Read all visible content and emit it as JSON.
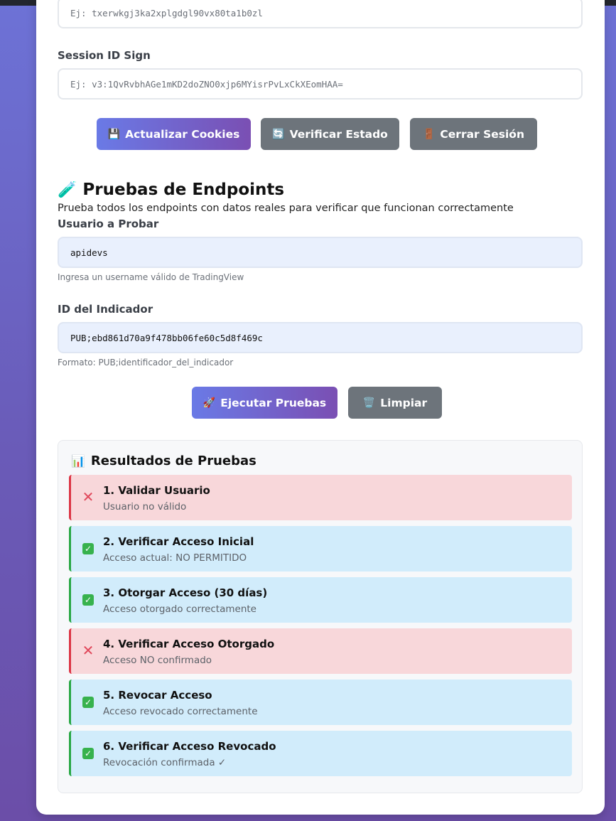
{
  "cookies": {
    "session_id_placeholder": "Ej: txerwkgj3ka2xplgdgl90vx80ta1b0zl",
    "session_sign_label": "Session ID Sign",
    "session_sign_placeholder": "Ej: v3:1QvRvbhAGe1mKD2doZNO0xjp6MYisrPvLxCkXEomHAA=",
    "buttons": {
      "update_icon": "💾",
      "update_label": "Actualizar Cookies",
      "verify_icon": "🔄",
      "verify_label": "Verificar Estado",
      "logout_icon": "🚪",
      "logout_label": "Cerrar Sesión"
    }
  },
  "tests": {
    "icon": "🧪",
    "title": "Pruebas de Endpoints",
    "description": "Prueba todos los endpoints con datos reales para verificar que funcionan correctamente",
    "user_label": "Usuario a Probar",
    "user_value": "apidevs",
    "user_help": "Ingresa un username válido de TradingView",
    "indicator_label": "ID del Indicador",
    "indicator_value": "PUB;ebd861d70a9f478bb06fe60c5d8f469c",
    "indicator_help": "Formato: PUB;identificador_del_indicador",
    "run_icon": "🚀",
    "run_label": "Ejecutar Pruebas",
    "clear_icon": "🗑️",
    "clear_label": "Limpiar"
  },
  "results": {
    "icon": "📊",
    "title": "Resultados de Pruebas",
    "items": [
      {
        "status": "error",
        "icon": "✕",
        "title": "1. Validar Usuario",
        "message": "Usuario no válido"
      },
      {
        "status": "ok",
        "icon": "✓",
        "title": "2. Verificar Acceso Inicial",
        "message": "Acceso actual: NO PERMITIDO"
      },
      {
        "status": "ok",
        "icon": "✓",
        "title": "3. Otorgar Acceso (30 días)",
        "message": "Acceso otorgado correctamente"
      },
      {
        "status": "error",
        "icon": "✕",
        "title": "4. Verificar Acceso Otorgado",
        "message": "Acceso NO confirmado"
      },
      {
        "status": "ok",
        "icon": "✓",
        "title": "5. Revocar Acceso",
        "message": "Acceso revocado correctamente"
      },
      {
        "status": "ok",
        "icon": "✓",
        "title": "6. Verificar Acceso Revocado",
        "message": "Revocación confirmada ✓"
      }
    ]
  },
  "colors": {
    "error_bg": "#f8d7da",
    "error_border": "#dc3545",
    "ok_bg": "#d1ecfb",
    "ok_border": "#28a745",
    "primary_gradient_start": "#6a7ae6",
    "primary_gradient_end": "#7a4fb3",
    "secondary_button": "#6d747b"
  }
}
